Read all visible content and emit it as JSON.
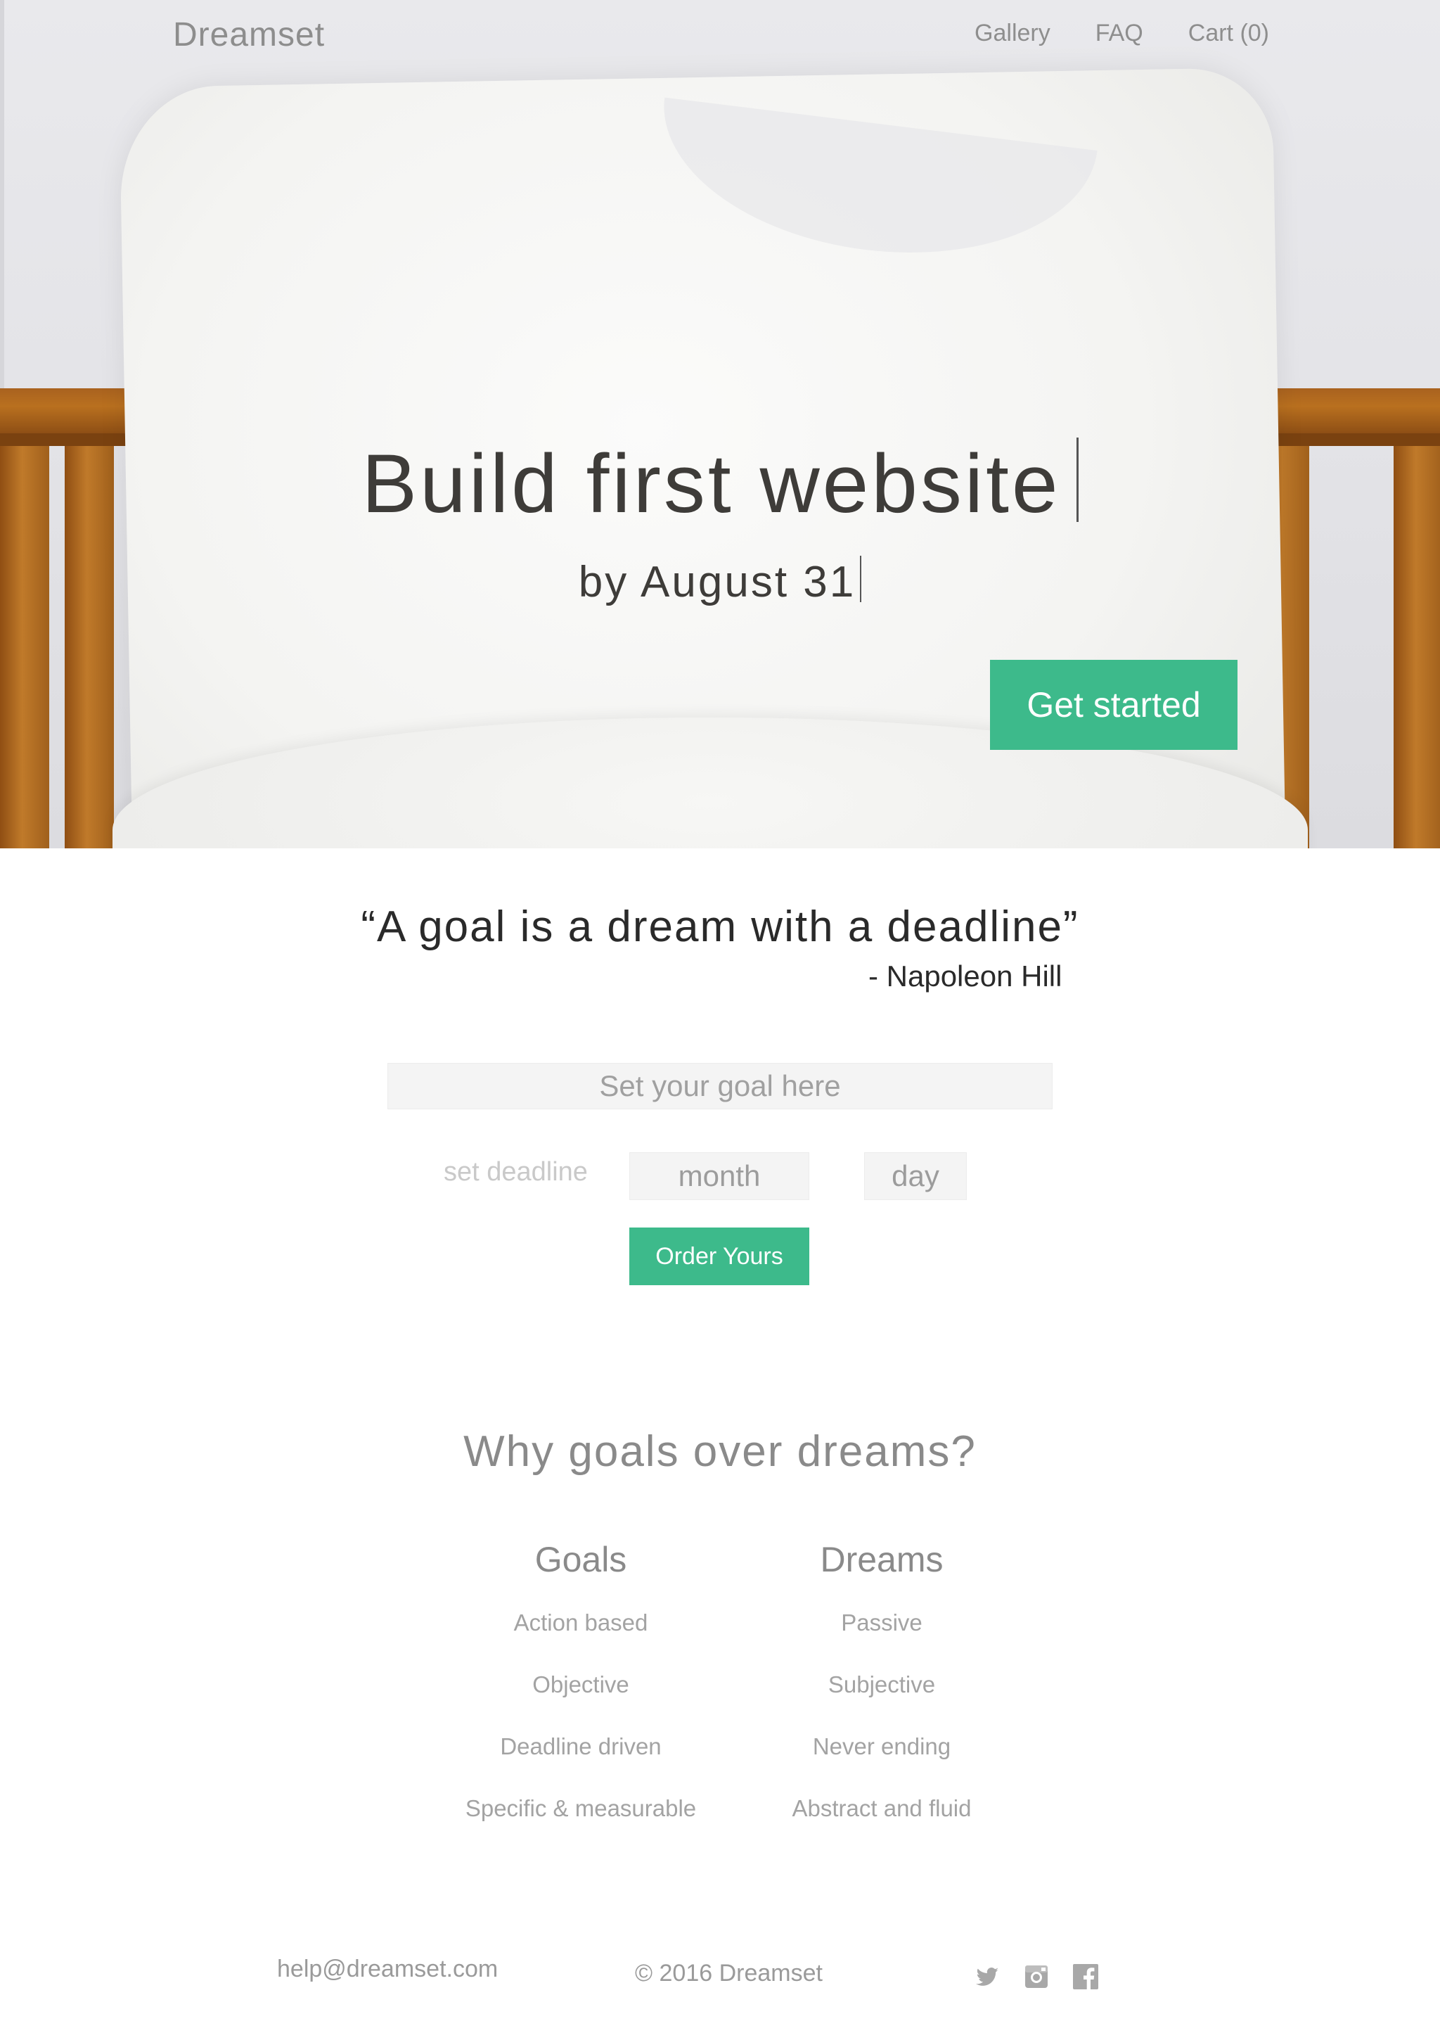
{
  "brand": "Dreamset",
  "nav": {
    "items": [
      "Gallery",
      "FAQ",
      "Cart (0)"
    ]
  },
  "hero": {
    "title": "Build first website",
    "subtitle": "by August 31",
    "cta_label": "Get started"
  },
  "quote": {
    "text": "“A goal is a dream with a deadline”",
    "author": "- Napoleon Hill"
  },
  "form": {
    "goal_placeholder": "Set your goal here",
    "deadline_label": "set deadline",
    "month_placeholder": "month",
    "day_placeholder": "day",
    "order_label": "Order Yours"
  },
  "why": {
    "title": "Why goals over dreams?",
    "goals": {
      "heading": "Goals",
      "items": [
        "Action based",
        "Objective",
        "Deadline driven",
        "Specific & measurable"
      ]
    },
    "dreams": {
      "heading": "Dreams",
      "items": [
        "Passive",
        "Subjective",
        "Never ending",
        "Abstract and fluid"
      ]
    }
  },
  "footer": {
    "email": "help@dreamset.com",
    "copyright": "© 2016 Dreamset",
    "social_icons": [
      "twitter-icon",
      "instagram-icon",
      "facebook-icon"
    ]
  },
  "colors": {
    "accent": "#3dba8b",
    "text_dark": "#3e3c39",
    "text_muted": "#9a9a9a"
  }
}
